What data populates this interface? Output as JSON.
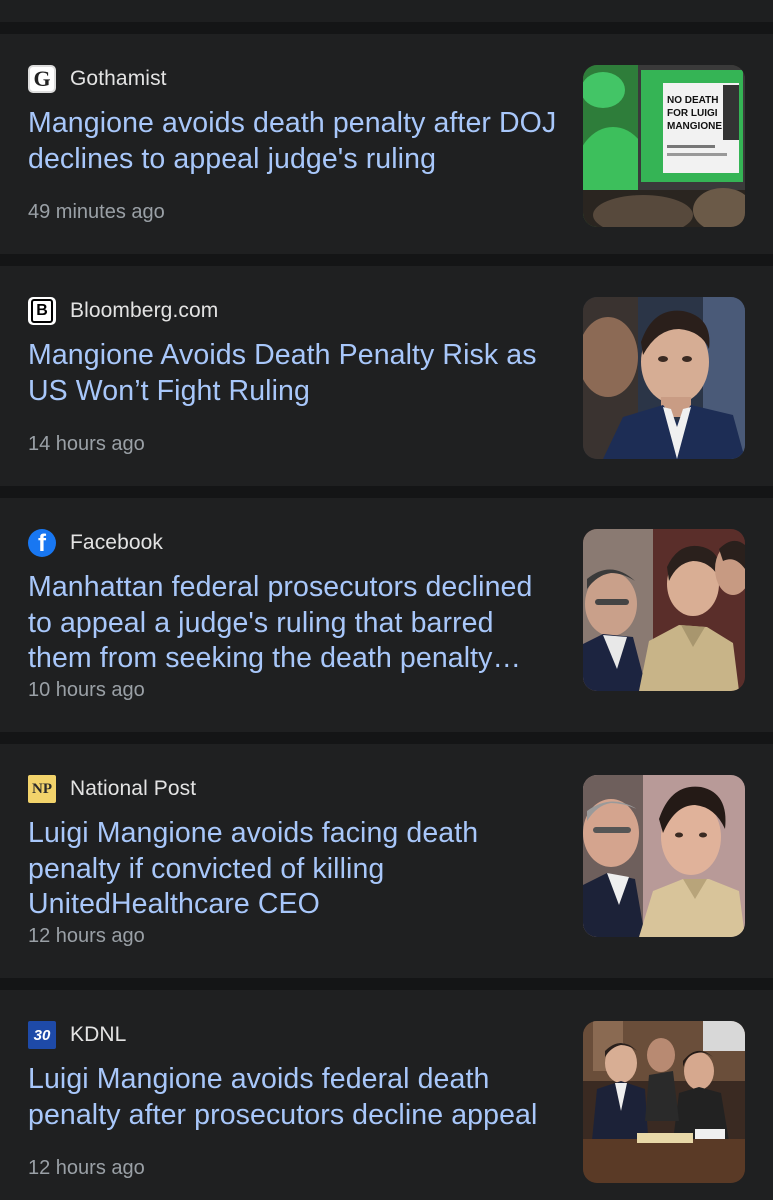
{
  "articles": [
    {
      "source": "Gothamist",
      "logo_text": "G",
      "headline": "Mangione avoids death penalty after DOJ declines to appeal judge's ruling",
      "time": "49 minutes ago",
      "image_sign_text": "NO DEATH FOR LUIGI MANGIONE"
    },
    {
      "source": "Bloomberg.com",
      "logo_text": "B",
      "headline": "Mangione Avoids Death Penalty Risk as US Won’t Fight Ruling",
      "time": "14 hours ago"
    },
    {
      "source": "Facebook",
      "logo_text": "f",
      "headline": "Manhattan federal prosecutors declined to appeal a judge's ruling that barred them from seeking the death penalty…",
      "time": "10 hours ago"
    },
    {
      "source": "National Post",
      "logo_text": "NP",
      "headline": "Luigi Mangione avoids facing death penalty if convicted of killing UnitedHealthcare CEO",
      "time": "12 hours ago"
    },
    {
      "source": "KDNL",
      "logo_text": "30",
      "headline": "Luigi Mangione avoids federal death penalty after prosecutors decline appeal",
      "time": "12 hours ago"
    }
  ],
  "colors": {
    "background": "#1e1f20",
    "headline": "#a8c7fa",
    "source": "#e3e3e3",
    "time": "#9aa0a6"
  }
}
